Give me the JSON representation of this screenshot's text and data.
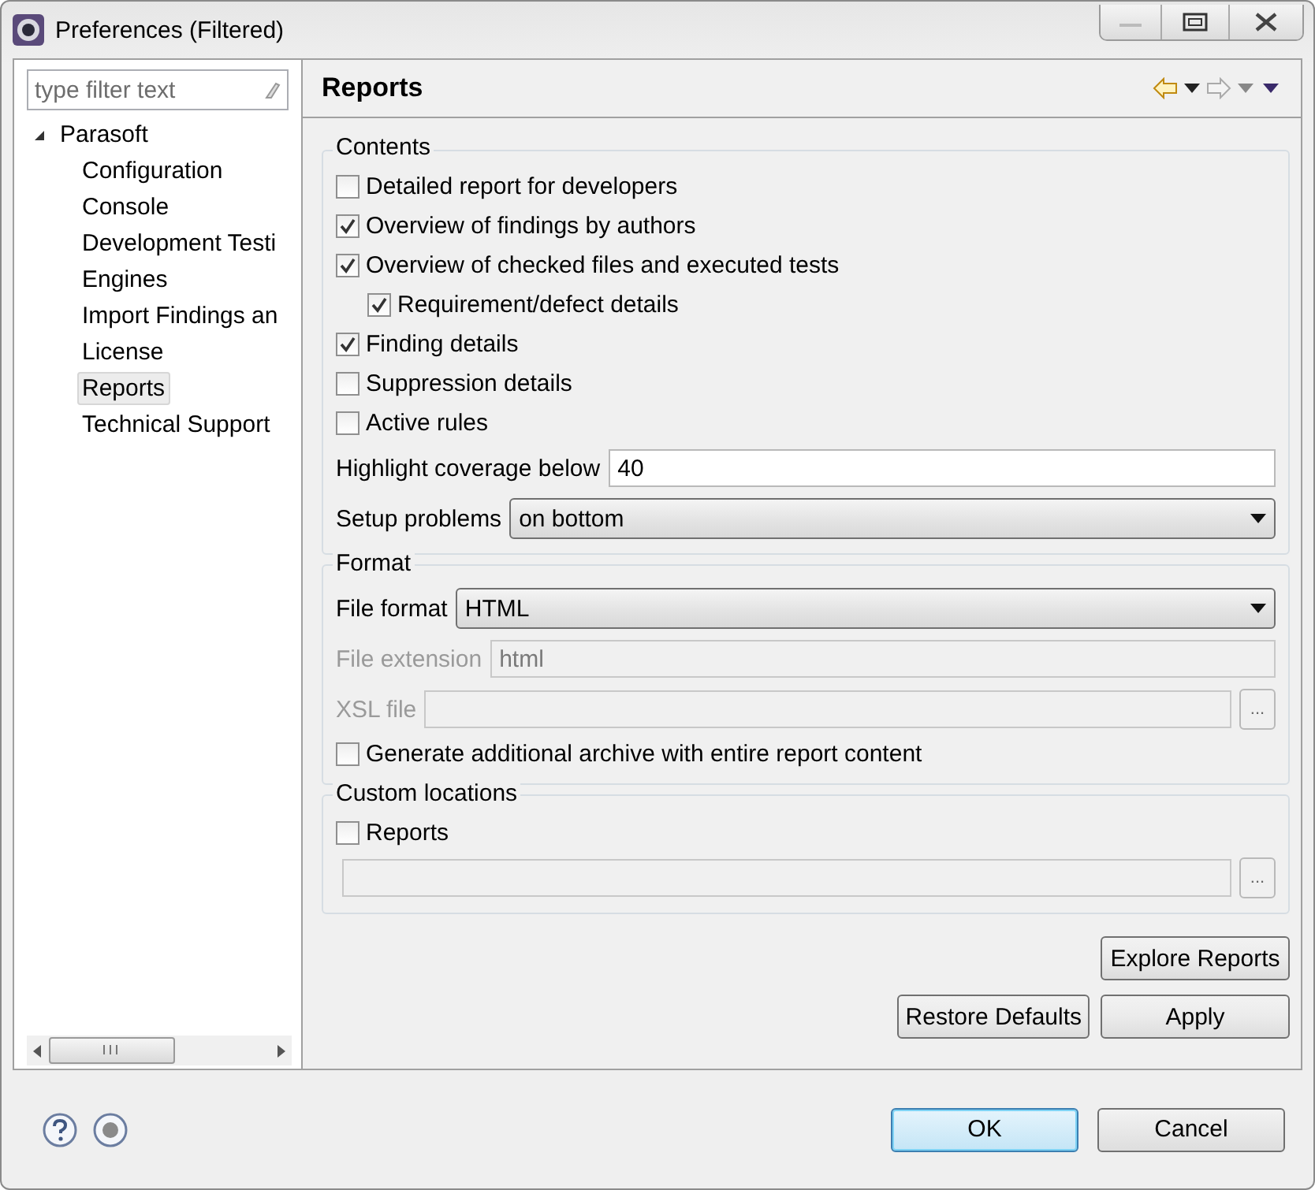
{
  "window": {
    "title": "Preferences (Filtered)"
  },
  "filter": {
    "placeholder": "type filter text"
  },
  "tree": [
    {
      "label": "Parasoft",
      "expanded": true,
      "selected": false,
      "children": [
        {
          "label": "Configuration",
          "selected": false
        },
        {
          "label": "Console",
          "selected": false
        },
        {
          "label": "Development Testi",
          "selected": false
        },
        {
          "label": "Engines",
          "selected": false
        },
        {
          "label": "Import Findings an",
          "selected": false
        },
        {
          "label": "License",
          "selected": false
        },
        {
          "label": "Reports",
          "selected": true
        },
        {
          "label": "Technical Support",
          "selected": false
        }
      ]
    }
  ],
  "page": {
    "title": "Reports"
  },
  "contents": {
    "title": "Contents",
    "options": [
      {
        "label": "Detailed report for developers",
        "checked": false
      },
      {
        "label": "Overview of findings by authors",
        "checked": true
      },
      {
        "label": "Overview of checked files and executed tests",
        "checked": true,
        "children": [
          {
            "label": "Requirement/defect details",
            "checked": true
          }
        ]
      },
      {
        "label": "Finding details",
        "checked": true
      },
      {
        "label": "Suppression details",
        "checked": false
      },
      {
        "label": "Active rules",
        "checked": false
      }
    ],
    "highlight": {
      "label": "Highlight coverage below",
      "value": "40"
    },
    "setup": {
      "label": "Setup problems",
      "value": "on bottom"
    }
  },
  "format": {
    "title": "Format",
    "file_format": {
      "label": "File format",
      "value": "HTML"
    },
    "file_extension": {
      "label": "File extension",
      "value": "html",
      "disabled": true
    },
    "xsl_file": {
      "label": "XSL file",
      "disabled": true,
      "browse": "..."
    },
    "archive": {
      "label": "Generate additional archive with entire report content",
      "checked": false
    }
  },
  "custom": {
    "title": "Custom locations",
    "reports": {
      "label": "Reports",
      "checked": false
    },
    "disabled": true,
    "browse": "..."
  },
  "actions": {
    "explore": "Explore Reports",
    "restore": "Restore Defaults",
    "apply": "Apply"
  },
  "dialog_buttons": [
    {
      "label": "OK",
      "default": true
    },
    {
      "label": "Cancel",
      "default": false
    }
  ]
}
